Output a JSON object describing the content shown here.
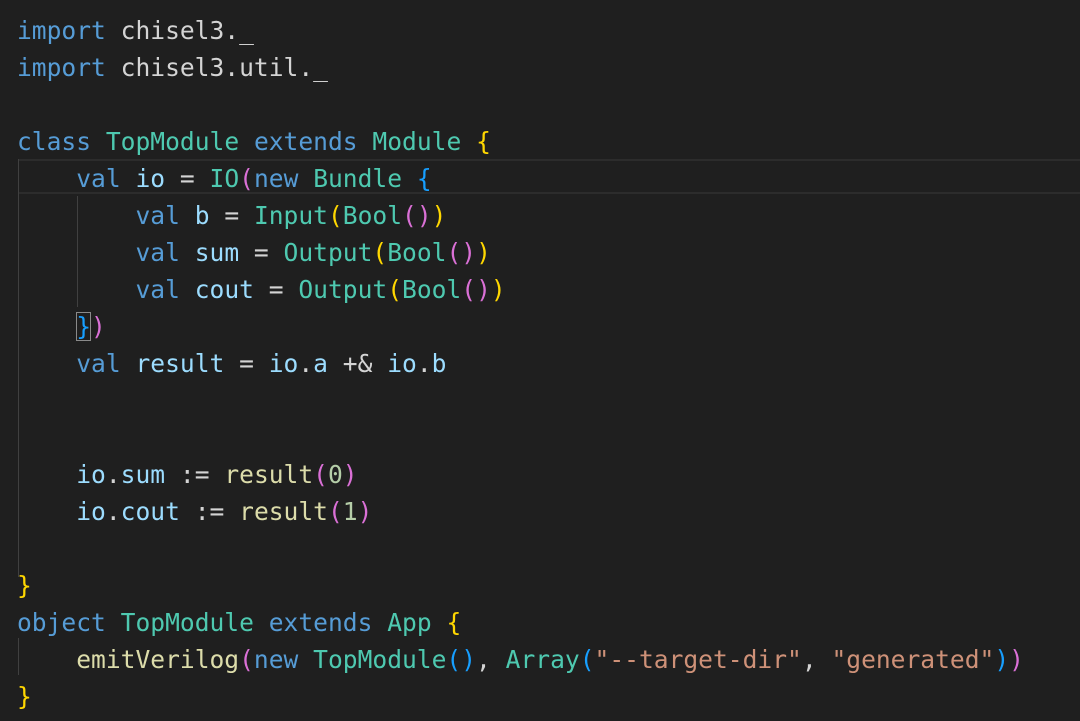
{
  "editor": {
    "lines": [
      "import chisel3._",
      "import chisel3.util._",
      "",
      "class TopModule extends Module {",
      "    val io = IO(new Bundle {",
      "        val b = Input(Bool())",
      "        val sum = Output(Bool())",
      "        val cout = Output(Bool())",
      "    })",
      "    val result = io.a +& io.b",
      "",
      "",
      "    io.sum := result(0)",
      "    io.cout := result(1)",
      "",
      "}",
      "object TopModule extends App {",
      "    emitVerilog(new TopModule(), Array(\"--target-dir\", \"generated\"))",
      "}"
    ],
    "syntax_colors": {
      "background": "#1f1f1f",
      "keyword": "#569cd6",
      "type": "#4ec9b0",
      "function": "#dcdcaa",
      "variable": "#9cdcfe",
      "string": "#ce9178",
      "number": "#b5cea8",
      "bracket_level_1": "#ffd700",
      "bracket_level_2": "#da70d6",
      "bracket_level_3": "#179fff"
    }
  }
}
